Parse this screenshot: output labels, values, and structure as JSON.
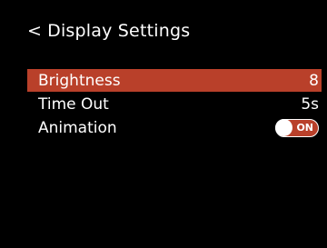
{
  "header": {
    "back_glyph": "<",
    "title": "Display Settings"
  },
  "menu": {
    "items": [
      {
        "label": "Brightness",
        "value": "8",
        "selected": true
      },
      {
        "label": "Time Out",
        "value": "5s",
        "selected": false
      },
      {
        "label": "Animation",
        "toggle_text": "ON",
        "toggle_state": "on",
        "selected": false
      }
    ]
  },
  "colors": {
    "background": "#000000",
    "accent": "#b9402a",
    "text": "#ffffff"
  },
  "icons": {
    "back": "chevron-left-icon",
    "toggle": "toggle-switch"
  }
}
